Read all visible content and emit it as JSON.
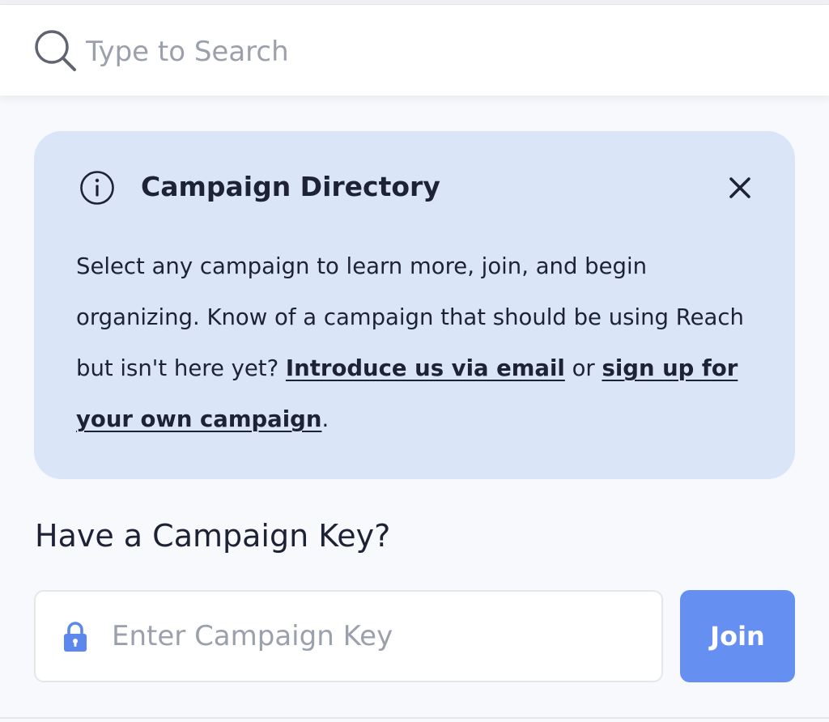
{
  "search": {
    "placeholder": "Type to Search",
    "icon": "search-icon"
  },
  "info_card": {
    "icon": "info-icon",
    "title": "Campaign Directory",
    "close_icon": "close-icon",
    "body_start": "Select any campaign to learn more, join, and begin organizing. Know of a campaign that should be using Reach but isn't here yet? ",
    "link_email": "Introduce us via email",
    "body_middle": " or ",
    "link_signup": "sign up for your own campaign",
    "body_end": ".",
    "background_color": "#dbe5f8"
  },
  "campaign_key": {
    "heading": "Have a Campaign Key?",
    "placeholder": "Enter Campaign Key",
    "lock_icon": "lock-icon",
    "lock_color": "#5b87ee",
    "join_label": "Join",
    "join_color": "#6590f2"
  }
}
